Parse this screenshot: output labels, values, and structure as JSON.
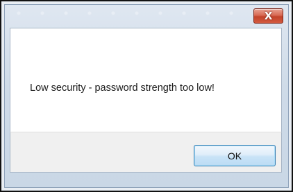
{
  "dialog": {
    "close_label": "X",
    "message": "Low security - password strength too low!",
    "ok_label": "OK"
  },
  "colors": {
    "close_button": "#c2432b",
    "ok_button_border": "#3c7fb1",
    "button_area_bg": "#f0f0f0"
  },
  "icons": {
    "close": "close-icon"
  }
}
